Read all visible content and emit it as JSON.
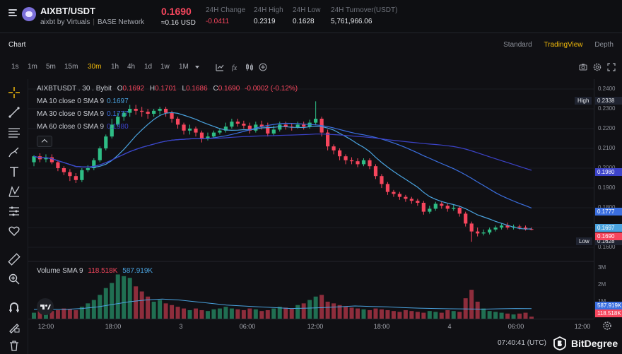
{
  "header": {
    "pair": "AIXBT/USDT",
    "subtitle": "aixbt by Virtuals",
    "network": "BASE Network",
    "price": "0.1690",
    "price_usd": "≈0.16 USD",
    "stats": [
      {
        "label": "24H Change",
        "value": "-0.0411",
        "negative": true
      },
      {
        "label": "24H High",
        "value": "0.2319",
        "negative": false
      },
      {
        "label": "24H Low",
        "value": "0.1628",
        "negative": false
      },
      {
        "label": "24H Turnover(USDT)",
        "value": "5,761,966.06",
        "negative": false
      }
    ]
  },
  "tabbar": {
    "title": "Chart",
    "views": [
      "Standard",
      "TradingView",
      "Depth"
    ],
    "active_view": "TradingView"
  },
  "toolbar": {
    "timeframes": [
      "1s",
      "1m",
      "5m",
      "15m",
      "30m",
      "1h",
      "4h",
      "1d",
      "1w",
      "1M"
    ],
    "active_timeframe": "30m",
    "icons": [
      "chevron-down-icon",
      "bar-type-icon",
      "indicator-icon",
      "compare-icon",
      "add-icon",
      "camera-icon",
      "settings-icon",
      "fullscreen-icon"
    ]
  },
  "left_tools": [
    "crosshair-icon",
    "trend-line-icon",
    "fib-icon",
    "brush-icon",
    "text-icon",
    "pattern-icon",
    "measure-icon",
    "heart-icon",
    "ruler-icon",
    "zoom-icon",
    "magnet-icon",
    "lock-draw-icon",
    "trash-icon"
  ],
  "legend": {
    "symbol": "AIXBTUSDT . 30 . Bybit",
    "ohlc": {
      "O": "0.1692",
      "H": "0.1701",
      "L": "0.1686",
      "C": "0.1690",
      "chg": "-0.0002 (-0.12%)"
    },
    "ma": [
      {
        "label": "MA 10 close 0 SMA 9",
        "value": "0.1697",
        "color": "#4aa3df"
      },
      {
        "label": "MA 30 close 0 SMA 9",
        "value": "0.1777",
        "color": "#3b6fe0"
      },
      {
        "label": "MA 60 close 0 SMA 9",
        "value": "0.1980",
        "color": "#3c43c9"
      }
    ],
    "volume_label": "Volume SMA 9",
    "volume_values": [
      "118.518K",
      "587.919K"
    ]
  },
  "chart_data": {
    "type": "candlestick",
    "ylim": [
      0.155,
      0.245
    ],
    "yticks": [
      "0.2400",
      "0.2300",
      "0.2200",
      "0.2100",
      "0.2000",
      "0.1900",
      "0.1800",
      "0.1700",
      "0.1600"
    ],
    "xticks": [
      "12:00",
      "18:00",
      "3",
      "06:00",
      "12:00",
      "18:00",
      "4",
      "06:00",
      "12:00"
    ],
    "high_label": "High",
    "high_value": "0.2338",
    "low_label": "Low",
    "low_value": "0.1628",
    "badges": [
      {
        "value": "0.1980",
        "color": "#3c43c9"
      },
      {
        "value": "0.1777",
        "color": "#3b6fe0"
      },
      {
        "value": "0.1697",
        "color": "#4aa3df"
      },
      {
        "value": "0.1690",
        "color": "#f6465d"
      }
    ],
    "candles": [
      [
        0.203,
        0.206,
        0.201,
        0.2065
      ],
      [
        0.206,
        0.2045,
        0.203,
        0.2075
      ],
      [
        0.2045,
        0.2055,
        0.203,
        0.207
      ],
      [
        0.2055,
        0.203,
        0.202,
        0.207
      ],
      [
        0.203,
        0.2,
        0.1985,
        0.204
      ],
      [
        0.2,
        0.198,
        0.1965,
        0.201
      ],
      [
        0.198,
        0.196,
        0.1935,
        0.1995
      ],
      [
        0.196,
        0.194,
        0.1925,
        0.1975
      ],
      [
        0.194,
        0.199,
        0.193,
        0.2
      ],
      [
        0.199,
        0.2,
        0.198,
        0.2015
      ],
      [
        0.2,
        0.204,
        0.199,
        0.205
      ],
      [
        0.204,
        0.21,
        0.203,
        0.211
      ],
      [
        0.21,
        0.216,
        0.209,
        0.217
      ],
      [
        0.216,
        0.222,
        0.215,
        0.225
      ],
      [
        0.222,
        0.226,
        0.221,
        0.228
      ],
      [
        0.226,
        0.228,
        0.224,
        0.229
      ],
      [
        0.228,
        0.23,
        0.226,
        0.232
      ],
      [
        0.23,
        0.229,
        0.227,
        0.232
      ],
      [
        0.229,
        0.2285,
        0.226,
        0.231
      ],
      [
        0.2285,
        0.2275,
        0.225,
        0.23
      ],
      [
        0.2275,
        0.229,
        0.226,
        0.23
      ],
      [
        0.229,
        0.23,
        0.227,
        0.231
      ],
      [
        0.23,
        0.228,
        0.226,
        0.231
      ],
      [
        0.228,
        0.225,
        0.223,
        0.229
      ],
      [
        0.225,
        0.222,
        0.22,
        0.226
      ],
      [
        0.222,
        0.219,
        0.217,
        0.223
      ],
      [
        0.219,
        0.22,
        0.217,
        0.222
      ],
      [
        0.22,
        0.218,
        0.216,
        0.221
      ],
      [
        0.218,
        0.215,
        0.213,
        0.219
      ],
      [
        0.215,
        0.216,
        0.214,
        0.218
      ],
      [
        0.216,
        0.218,
        0.215,
        0.219
      ],
      [
        0.218,
        0.219,
        0.217,
        0.22
      ],
      [
        0.219,
        0.221,
        0.218,
        0.223
      ],
      [
        0.221,
        0.2235,
        0.22,
        0.225
      ],
      [
        0.2235,
        0.2225,
        0.221,
        0.225
      ],
      [
        0.2225,
        0.2215,
        0.22,
        0.224
      ],
      [
        0.2215,
        0.219,
        0.2175,
        0.223
      ],
      [
        0.219,
        0.222,
        0.218,
        0.2235
      ],
      [
        0.222,
        0.221,
        0.2195,
        0.224
      ],
      [
        0.221,
        0.2175,
        0.216,
        0.223
      ],
      [
        0.2175,
        0.2195,
        0.2165,
        0.2215
      ],
      [
        0.2195,
        0.222,
        0.2185,
        0.2235
      ],
      [
        0.222,
        0.221,
        0.2195,
        0.2235
      ],
      [
        0.221,
        0.2205,
        0.219,
        0.2225
      ],
      [
        0.2205,
        0.222,
        0.22,
        0.2235
      ],
      [
        0.222,
        0.221,
        0.2195,
        0.2235
      ],
      [
        0.221,
        0.223,
        0.22,
        0.2245
      ],
      [
        0.223,
        0.225,
        0.222,
        0.2338
      ],
      [
        0.225,
        0.218,
        0.216,
        0.226
      ],
      [
        0.218,
        0.211,
        0.209,
        0.2195
      ],
      [
        0.211,
        0.209,
        0.207,
        0.212
      ],
      [
        0.209,
        0.206,
        0.204,
        0.21
      ],
      [
        0.206,
        0.204,
        0.202,
        0.207
      ],
      [
        0.204,
        0.2035,
        0.202,
        0.2055
      ],
      [
        0.2035,
        0.202,
        0.2005,
        0.205
      ],
      [
        0.202,
        0.204,
        0.201,
        0.205
      ],
      [
        0.204,
        0.201,
        0.1995,
        0.205
      ],
      [
        0.201,
        0.196,
        0.1945,
        0.202
      ],
      [
        0.196,
        0.192,
        0.19,
        0.197
      ],
      [
        0.192,
        0.188,
        0.1865,
        0.193
      ],
      [
        0.188,
        0.187,
        0.1855,
        0.189
      ],
      [
        0.187,
        0.1855,
        0.184,
        0.188
      ],
      [
        0.1855,
        0.1845,
        0.183,
        0.1865
      ],
      [
        0.1845,
        0.1835,
        0.182,
        0.1855
      ],
      [
        0.1835,
        0.1825,
        0.181,
        0.1845
      ],
      [
        0.1825,
        0.178,
        0.1765,
        0.1835
      ],
      [
        0.178,
        0.1795,
        0.177,
        0.181
      ],
      [
        0.1795,
        0.182,
        0.1785,
        0.183
      ],
      [
        0.182,
        0.181,
        0.1795,
        0.183
      ],
      [
        0.181,
        0.1795,
        0.178,
        0.182
      ],
      [
        0.1795,
        0.18,
        0.1785,
        0.1815
      ],
      [
        0.18,
        0.177,
        0.1755,
        0.181
      ],
      [
        0.177,
        0.172,
        0.1705,
        0.178
      ],
      [
        0.172,
        0.168,
        0.1628,
        0.173
      ],
      [
        0.168,
        0.167,
        0.1655,
        0.17
      ],
      [
        0.167,
        0.1675,
        0.166,
        0.169
      ],
      [
        0.1675,
        0.169,
        0.1665,
        0.17
      ],
      [
        0.169,
        0.17,
        0.168,
        0.171
      ],
      [
        0.17,
        0.171,
        0.169,
        0.172
      ],
      [
        0.171,
        0.17,
        0.169,
        0.1725
      ],
      [
        0.17,
        0.1705,
        0.169,
        0.1715
      ],
      [
        0.1705,
        0.17,
        0.169,
        0.1715
      ],
      [
        0.17,
        0.1692,
        0.1685,
        0.171
      ],
      [
        0.1692,
        0.169,
        0.1686,
        0.1701
      ]
    ],
    "volume_axis": [
      "3M",
      "2M",
      "1M"
    ],
    "volume_badges": [
      {
        "value": "587.919K",
        "color": "#3b6fe0"
      },
      {
        "value": "118.518K",
        "color": "#f6465d"
      }
    ],
    "volumes": [
      0.35,
      0.55,
      0.5,
      0.45,
      0.5,
      0.6,
      0.55,
      0.5,
      0.7,
      0.9,
      1.1,
      1.4,
      1.8,
      2.1,
      2.6,
      2.5,
      2.4,
      1.9,
      1.6,
      1.3,
      1.0,
      1.1,
      0.9,
      0.8,
      0.7,
      0.6,
      0.5,
      0.6,
      0.5,
      0.45,
      0.55,
      0.6,
      0.7,
      0.6,
      0.55,
      0.5,
      0.6,
      0.55,
      0.45,
      0.5,
      0.6,
      0.7,
      0.65,
      0.6,
      0.8,
      0.9,
      1.1,
      1.3,
      1.4,
      1.0,
      0.9,
      0.8,
      0.7,
      0.65,
      0.6,
      0.55,
      0.5,
      0.6,
      0.55,
      0.5,
      0.45,
      0.4,
      0.5,
      0.45,
      0.4,
      0.35,
      0.45,
      0.4,
      0.35,
      0.5,
      0.45,
      0.4,
      1.2,
      1.7,
      1.0,
      0.6,
      0.45,
      0.4,
      0.35,
      0.3,
      0.25,
      0.3,
      0.35,
      0.12
    ],
    "volume_ma": [
      0.55,
      0.55,
      0.55,
      0.6,
      0.7,
      0.85,
      1.0,
      1.1,
      1.15,
      1.1,
      1.0,
      0.9,
      0.8,
      0.75,
      0.7,
      0.65,
      0.6,
      0.62,
      0.65,
      0.7,
      0.75,
      0.72,
      0.7,
      0.65,
      0.62,
      0.6,
      0.58,
      0.57,
      0.56,
      0.58,
      0.6,
      0.59
    ]
  },
  "footer": {
    "time": "07:40:41 (UTC)",
    "brand": "BitDegree"
  }
}
